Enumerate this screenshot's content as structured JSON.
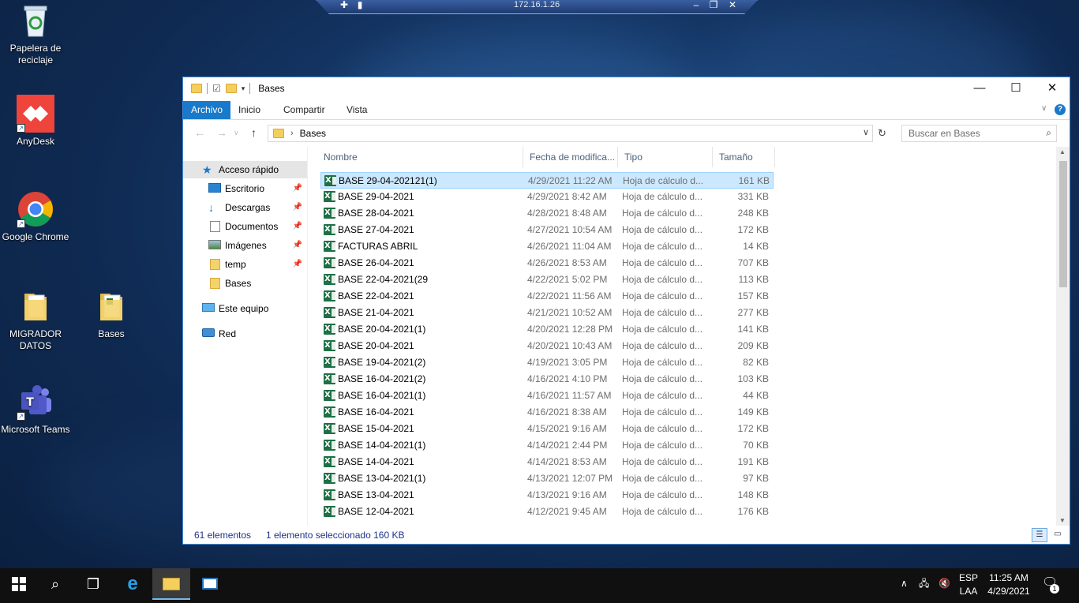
{
  "remote_bar": {
    "title": "172.16.1.26"
  },
  "desktop": {
    "icons": [
      {
        "label": "Papelera de reciclaje"
      },
      {
        "label": "AnyDesk"
      },
      {
        "label": "Google Chrome"
      },
      {
        "label": "MIGRADOR DATOS"
      },
      {
        "label": "Bases"
      },
      {
        "label": "Microsoft Teams"
      }
    ]
  },
  "explorer": {
    "window_title": "Bases",
    "ribbon_tabs": [
      "Archivo",
      "Inicio",
      "Compartir",
      "Vista"
    ],
    "address_crumb": "Bases",
    "search_placeholder": "Buscar en Bases",
    "nav": [
      {
        "label": "Acceso rápido",
        "icon": "star-icon"
      },
      {
        "label": "Escritorio",
        "icon": "desktop-icon",
        "pinned": true
      },
      {
        "label": "Descargas",
        "icon": "download-icon",
        "pinned": true
      },
      {
        "label": "Documentos",
        "icon": "documents-icon",
        "pinned": true
      },
      {
        "label": "Imágenes",
        "icon": "pictures-icon",
        "pinned": true
      },
      {
        "label": "temp",
        "icon": "folder-icon",
        "pinned": true
      },
      {
        "label": "Bases",
        "icon": "folder-icon"
      },
      {
        "label": "Este equipo",
        "icon": "computer-icon"
      },
      {
        "label": "Red",
        "icon": "network-icon"
      }
    ],
    "columns": {
      "name": "Nombre",
      "date": "Fecha de modifica...",
      "type": "Tipo",
      "size": "Tamaño"
    },
    "files": [
      {
        "name": "BASE 29-04-202121(1)",
        "date": "4/29/2021 11:22 AM",
        "type": "Hoja de cálculo d...",
        "size": "161 KB"
      },
      {
        "name": "BASE 29-04-2021",
        "date": "4/29/2021 8:42 AM",
        "type": "Hoja de cálculo d...",
        "size": "331 KB"
      },
      {
        "name": "BASE 28-04-2021",
        "date": "4/28/2021 8:48 AM",
        "type": "Hoja de cálculo d...",
        "size": "248 KB"
      },
      {
        "name": "BASE 27-04-2021",
        "date": "4/27/2021 10:54 AM",
        "type": "Hoja de cálculo d...",
        "size": "172 KB"
      },
      {
        "name": "FACTURAS ABRIL",
        "date": "4/26/2021 11:04 AM",
        "type": "Hoja de cálculo d...",
        "size": "14 KB"
      },
      {
        "name": "BASE 26-04-2021",
        "date": "4/26/2021 8:53 AM",
        "type": "Hoja de cálculo d...",
        "size": "707 KB"
      },
      {
        "name": "BASE 22-04-2021(29",
        "date": "4/22/2021 5:02 PM",
        "type": "Hoja de cálculo d...",
        "size": "113 KB"
      },
      {
        "name": "BASE 22-04-2021",
        "date": "4/22/2021 11:56 AM",
        "type": "Hoja de cálculo d...",
        "size": "157 KB"
      },
      {
        "name": "BASE 21-04-2021",
        "date": "4/21/2021 10:52 AM",
        "type": "Hoja de cálculo d...",
        "size": "277 KB"
      },
      {
        "name": "BASE 20-04-2021(1)",
        "date": "4/20/2021 12:28 PM",
        "type": "Hoja de cálculo d...",
        "size": "141 KB"
      },
      {
        "name": "BASE 20-04-2021",
        "date": "4/20/2021 10:43 AM",
        "type": "Hoja de cálculo d...",
        "size": "209 KB"
      },
      {
        "name": "BASE 19-04-2021(2)",
        "date": "4/19/2021 3:05 PM",
        "type": "Hoja de cálculo d...",
        "size": "82 KB"
      },
      {
        "name": "BASE 16-04-2021(2)",
        "date": "4/16/2021 4:10 PM",
        "type": "Hoja de cálculo d...",
        "size": "103 KB"
      },
      {
        "name": "BASE 16-04-2021(1)",
        "date": "4/16/2021 11:57 AM",
        "type": "Hoja de cálculo d...",
        "size": "44 KB"
      },
      {
        "name": "BASE 16-04-2021",
        "date": "4/16/2021 8:38 AM",
        "type": "Hoja de cálculo d...",
        "size": "149 KB"
      },
      {
        "name": "BASE 15-04-2021",
        "date": "4/15/2021 9:16 AM",
        "type": "Hoja de cálculo d...",
        "size": "172 KB"
      },
      {
        "name": "BASE 14-04-2021(1)",
        "date": "4/14/2021 2:44 PM",
        "type": "Hoja de cálculo d...",
        "size": "70 KB"
      },
      {
        "name": "BASE 14-04-2021",
        "date": "4/14/2021 8:53 AM",
        "type": "Hoja de cálculo d...",
        "size": "191 KB"
      },
      {
        "name": "BASE 13-04-2021(1)",
        "date": "4/13/2021 12:07 PM",
        "type": "Hoja de cálculo d...",
        "size": "97 KB"
      },
      {
        "name": "BASE 13-04-2021",
        "date": "4/13/2021 9:16 AM",
        "type": "Hoja de cálculo d...",
        "size": "148 KB"
      },
      {
        "name": "BASE 12-04-2021",
        "date": "4/12/2021 9:45 AM",
        "type": "Hoja de cálculo d...",
        "size": "176 KB"
      }
    ],
    "status": {
      "count": "61 elementos",
      "selection": "1 elemento seleccionado 160 KB"
    }
  },
  "taskbar": {
    "lang_top": "ESP",
    "lang_bottom": "LAA",
    "time": "11:25 AM",
    "date": "4/29/2021",
    "notif_count": "1"
  },
  "colors": {
    "accent": "#1979ca",
    "selection": "#cce8ff",
    "excel": "#1d7044"
  }
}
